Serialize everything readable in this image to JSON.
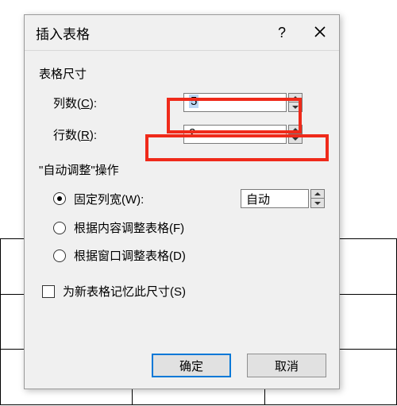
{
  "dialog": {
    "title": "插入表格",
    "help_tooltip": "?",
    "close_tooltip": "×"
  },
  "size_section": {
    "label": "表格尺寸",
    "columns": {
      "label_prefix": "列数(",
      "accel": "C",
      "label_suffix": "):",
      "value": "5"
    },
    "rows": {
      "label_prefix": "行数(",
      "accel": "R",
      "label_suffix": "):",
      "value": "2"
    }
  },
  "autofit_section": {
    "label": "\"自动调整\"操作",
    "fixed_width": {
      "label_prefix": "固定列宽(",
      "accel": "W",
      "label_suffix": "):",
      "value": "自动",
      "checked": true
    },
    "fit_contents": {
      "label_prefix": "根据内容调整表格(",
      "accel": "F",
      "label_suffix": ")",
      "checked": false
    },
    "fit_window": {
      "label_prefix": "根据窗口调整表格(",
      "accel": "D",
      "label_suffix": ")",
      "checked": false
    }
  },
  "remember": {
    "label_prefix": "为新表格记忆此尺寸(",
    "accel": "S",
    "label_suffix": ")",
    "checked": false
  },
  "buttons": {
    "ok": "确定",
    "cancel": "取消"
  }
}
